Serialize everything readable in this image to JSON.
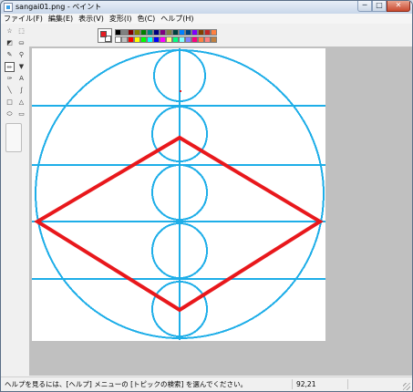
{
  "window": {
    "title": "sangai01.png - ペイント",
    "buttons": {
      "minimize": "─",
      "maximize": "□",
      "close": "✕"
    }
  },
  "menu": [
    "ファイル(F)",
    "編集(E)",
    "表示(V)",
    "変形(I)",
    "色(C)",
    "ヘルプ(H)"
  ],
  "tools": [
    {
      "name": "free-select-icon",
      "glyph": "☆",
      "active": false
    },
    {
      "name": "rect-select-icon",
      "glyph": "⬚",
      "active": false
    },
    {
      "name": "eraser-icon",
      "glyph": "◩",
      "active": false
    },
    {
      "name": "fill-icon",
      "glyph": "⛀",
      "active": false
    },
    {
      "name": "color-picker-icon",
      "glyph": "✎",
      "active": false
    },
    {
      "name": "magnifier-icon",
      "glyph": "⚲",
      "active": false
    },
    {
      "name": "pencil-icon",
      "glyph": "✏",
      "active": true
    },
    {
      "name": "brush-icon",
      "glyph": "▼",
      "active": false
    },
    {
      "name": "airbrush-icon",
      "glyph": "✑",
      "active": false
    },
    {
      "name": "text-icon",
      "glyph": "A",
      "active": false
    },
    {
      "name": "line-icon",
      "glyph": "╲",
      "active": false
    },
    {
      "name": "curve-icon",
      "glyph": "∫",
      "active": false
    },
    {
      "name": "rectangle-icon",
      "glyph": "□",
      "active": false
    },
    {
      "name": "polygon-icon",
      "glyph": "△",
      "active": false
    },
    {
      "name": "ellipse-icon",
      "glyph": "⬭",
      "active": false
    },
    {
      "name": "rounded-rect-icon",
      "glyph": "▭",
      "active": false
    }
  ],
  "colors": {
    "foreground": "#e81c23",
    "background": "#ffffff",
    "palette_top": [
      "#000000",
      "#808080",
      "#800000",
      "#808000",
      "#008000",
      "#008080",
      "#000080",
      "#800080",
      "#808040",
      "#004040",
      "#0080ff",
      "#004080",
      "#8000ff",
      "#804000",
      "#c02828",
      "#ff8040"
    ],
    "palette_bottom": [
      "#ffffff",
      "#c0c0c0",
      "#ff0000",
      "#ffff00",
      "#00ff00",
      "#00ffff",
      "#0000ff",
      "#ff00ff",
      "#ffff80",
      "#00ff80",
      "#80ffff",
      "#8080ff",
      "#ff0080",
      "#ff8040",
      "#ff8080",
      "#c08040"
    ]
  },
  "drawing": {
    "line_color": "#1eaee8",
    "shape_color": "#e8181c"
  },
  "status": {
    "help_text": "ヘルプを見るには、[ヘルプ] メニューの [トピックの検索] を選んでください。",
    "coords": "92,21"
  }
}
